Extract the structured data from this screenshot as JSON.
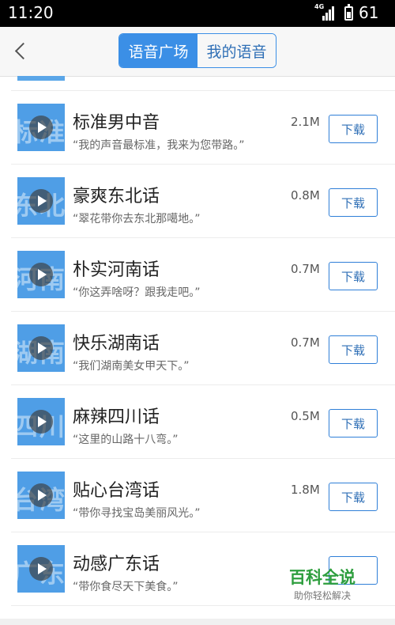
{
  "status_bar": {
    "time": "11:20",
    "network_label": "4G",
    "battery_level": "61"
  },
  "header": {
    "tabs": [
      {
        "label": "语音广场",
        "active": true
      },
      {
        "label": "我的语音",
        "active": false
      }
    ]
  },
  "voices": [
    {
      "title": "标准男中音",
      "quote": "“我的声音最标准，我来为您带路。”",
      "size": "2.1M",
      "thumb_text": "标准",
      "action": "下载"
    },
    {
      "title": "豪爽东北话",
      "quote": "“翠花带你去东北那噶地。”",
      "size": "0.8M",
      "thumb_text": "东北",
      "action": "下载"
    },
    {
      "title": "朴实河南话",
      "quote": "“你这弄啥呀？跟我走吧。”",
      "size": "0.7M",
      "thumb_text": "河南",
      "action": "下载"
    },
    {
      "title": "快乐湖南话",
      "quote": "“我们湖南美女甲天下。”",
      "size": "0.7M",
      "thumb_text": "湖南",
      "action": "下载"
    },
    {
      "title": "麻辣四川话",
      "quote": "“这里的山路十八弯。”",
      "size": "0.5M",
      "thumb_text": "四川",
      "action": "下载"
    },
    {
      "title": "贴心台湾话",
      "quote": "“带你寻找宝岛美丽风光。”",
      "size": "1.8M",
      "thumb_text": "台湾",
      "action": "下载"
    },
    {
      "title": "动感广东话",
      "quote": "“带你食尽天下美食。”",
      "size": "",
      "thumb_text": "广东",
      "action": ""
    }
  ],
  "watermark": {
    "title": "百科全说",
    "subtitle": "助你轻松解决"
  },
  "colors": {
    "accent": "#3b8fe6",
    "thumb": "#4f9ee6",
    "watermark": "#2e9e3e"
  }
}
